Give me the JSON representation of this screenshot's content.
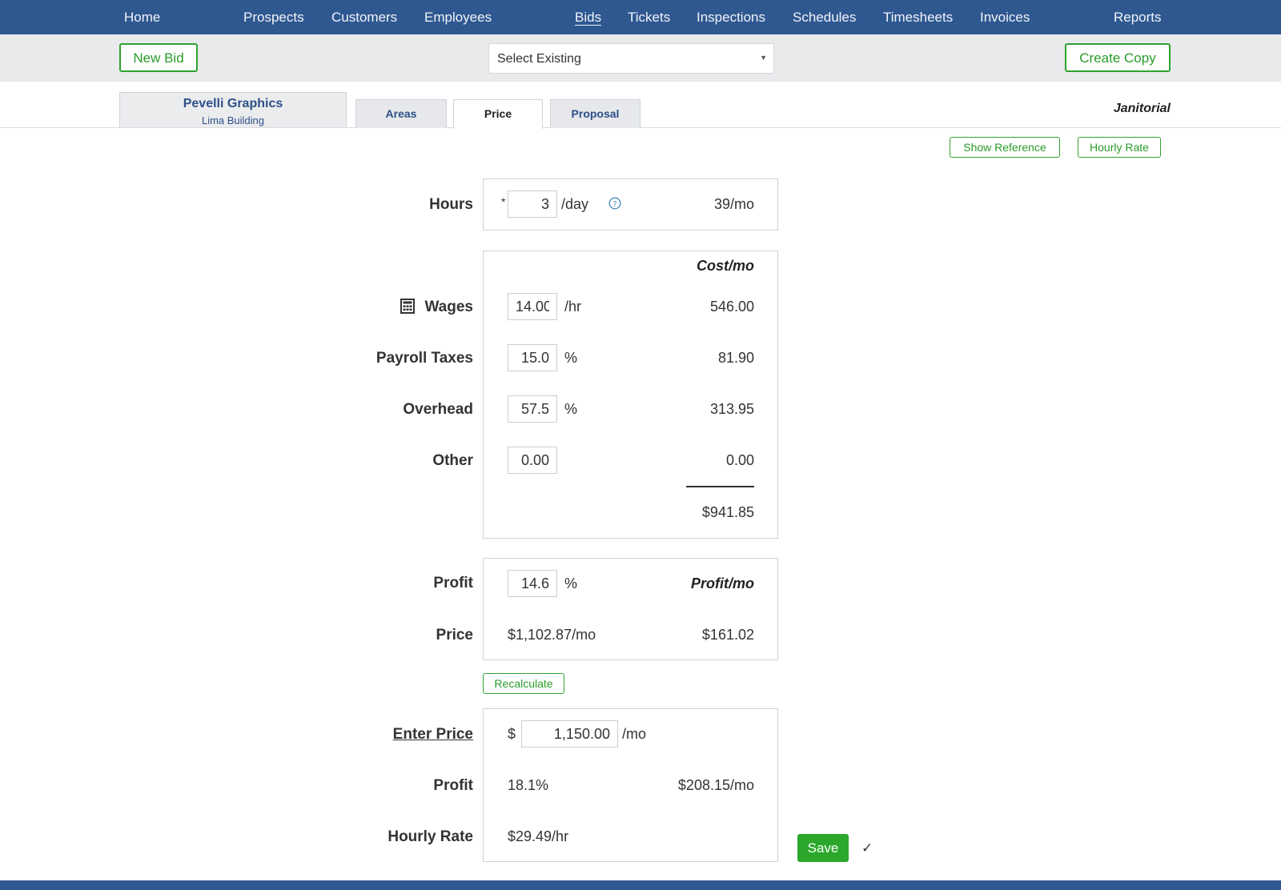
{
  "nav": {
    "home": "Home",
    "prospects": "Prospects",
    "customers": "Customers",
    "employees": "Employees",
    "bids": "Bids",
    "tickets": "Tickets",
    "inspections": "Inspections",
    "schedules": "Schedules",
    "timesheets": "Timesheets",
    "invoices": "Invoices",
    "reports": "Reports"
  },
  "toolbar": {
    "new_bid": "New Bid",
    "select_existing": "Select Existing",
    "create_copy": "Create Copy"
  },
  "client": {
    "name": "Pevelli Graphics",
    "site": "Lima Building"
  },
  "tabs": {
    "areas": "Areas",
    "price": "Price",
    "proposal": "Proposal"
  },
  "service_type": "Janitorial",
  "actions": {
    "show_reference": "Show Reference",
    "hourly_rate": "Hourly Rate",
    "recalculate": "Recalculate",
    "save": "Save",
    "saved_check": "✓"
  },
  "hours": {
    "label": "Hours",
    "required_mark": "*",
    "value": "3",
    "unit": "/day",
    "monthly": "39/mo"
  },
  "costs": {
    "header": "Cost/mo",
    "wages": {
      "label": "Wages",
      "value": "14.00",
      "unit": "/hr",
      "monthly": "546.00"
    },
    "payroll_taxes": {
      "label": "Payroll Taxes",
      "value": "15.0",
      "unit": "%",
      "monthly": "81.90"
    },
    "overhead": {
      "label": "Overhead",
      "value": "57.5",
      "unit": "%",
      "monthly": "313.95"
    },
    "other": {
      "label": "Other",
      "value": "0.00",
      "monthly": "0.00"
    },
    "total": "$941.85"
  },
  "profit_calc": {
    "profit_label": "Profit",
    "profit_value": "14.6",
    "profit_unit": "%",
    "header": "Profit/mo",
    "price_label": "Price",
    "price_value": "$1,102.87/mo",
    "profit_monthly": "$161.02"
  },
  "enter_price": {
    "label": "Enter Price",
    "currency": "$",
    "value": "1,150.00",
    "unit": "/mo",
    "profit_label": "Profit",
    "profit_pct": "18.1%",
    "profit_monthly": "$208.15/mo",
    "hourly_label": "Hourly Rate",
    "hourly_value": "$29.49/hr"
  },
  "colors": {
    "nav_bg": "#2f5891",
    "accent_green": "#2ba82b",
    "toolbar_bg": "#e9eaec"
  }
}
